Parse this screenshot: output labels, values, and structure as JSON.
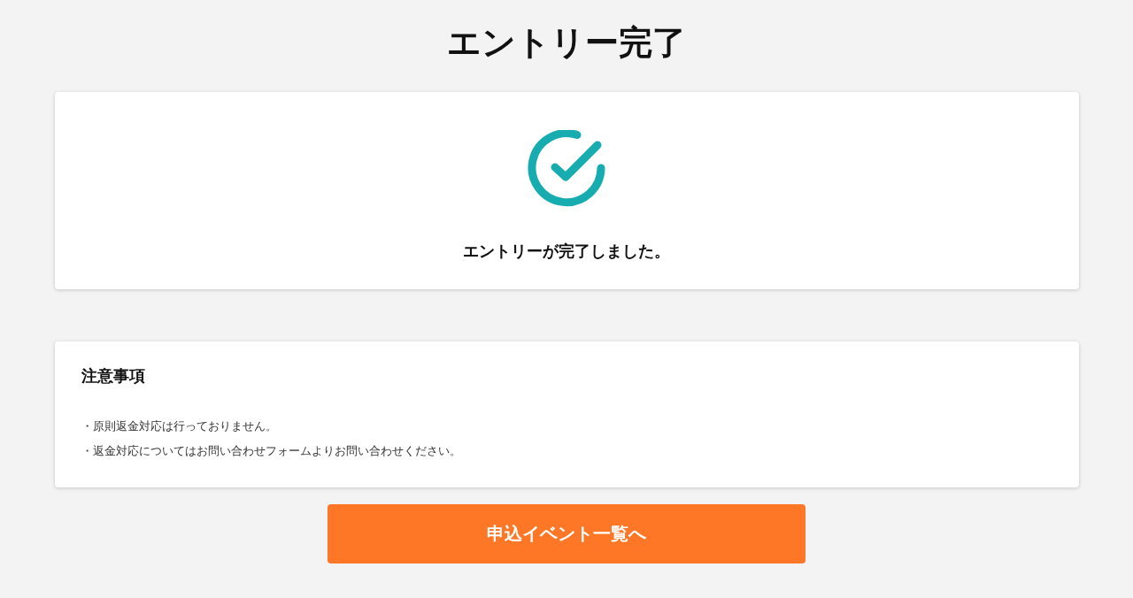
{
  "page": {
    "title": "エントリー完了"
  },
  "completion_card": {
    "message": "エントリーが完了しました。"
  },
  "notes_card": {
    "heading": "注意事項",
    "items": [
      "・原則返金対応は行っておりません。",
      "・返金対応についてはお問い合わせフォームよりお問い合わせください。"
    ]
  },
  "action_button": {
    "label": "申込イベント一覧へ"
  }
}
